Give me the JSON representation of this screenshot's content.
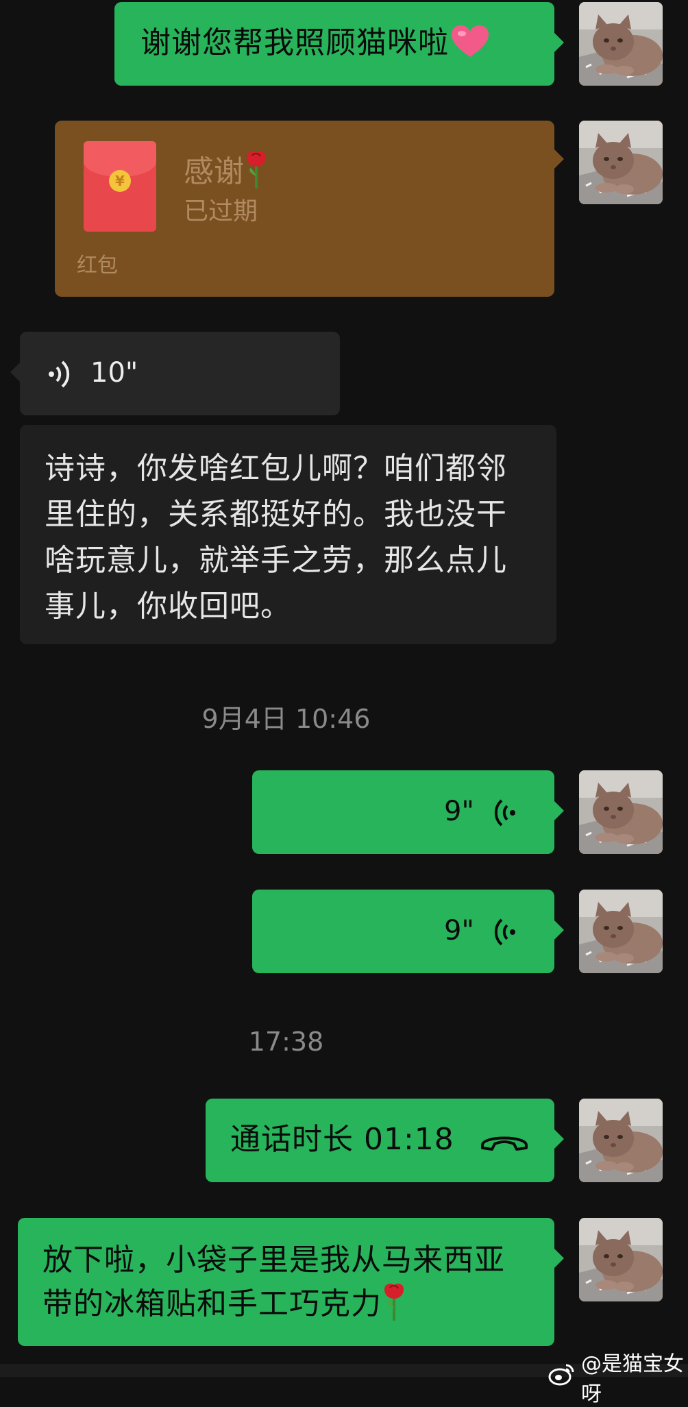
{
  "messages": {
    "m1": {
      "text": "谢谢您帮我照顾猫咪啦"
    },
    "m2": {
      "title": "感谢",
      "status": "已过期",
      "label": "红包"
    },
    "m3": {
      "duration": "10\""
    },
    "m4": {
      "text": "诗诗，你发啥红包儿啊？咱们都邻里住的，关系都挺好的。我也没干啥玩意儿，就举手之劳，那么点儿事儿，你收回吧。"
    },
    "ts1": {
      "text": "9月4日 10:46"
    },
    "m5": {
      "duration": "9\""
    },
    "m6": {
      "duration": "9\""
    },
    "ts2": {
      "text": "17:38"
    },
    "m7": {
      "text": "通话时长 01:18"
    },
    "m8": {
      "text": "放下啦，小袋子里是我从马来西亚带的冰箱贴和手工巧克力"
    }
  },
  "watermark": {
    "text": "@是猫宝女呀"
  },
  "icons": {
    "heart": "heart-emoji-icon",
    "rose": "rose-emoji-icon",
    "voice": "voice-wave-icon",
    "call": "phone-call-icon",
    "weibo": "weibo-logo-icon"
  },
  "colors": {
    "background": "#111111",
    "sent_bubble": "#27b45b",
    "received_bubble": "#262626",
    "red_packet_expired": "#7a5020"
  }
}
